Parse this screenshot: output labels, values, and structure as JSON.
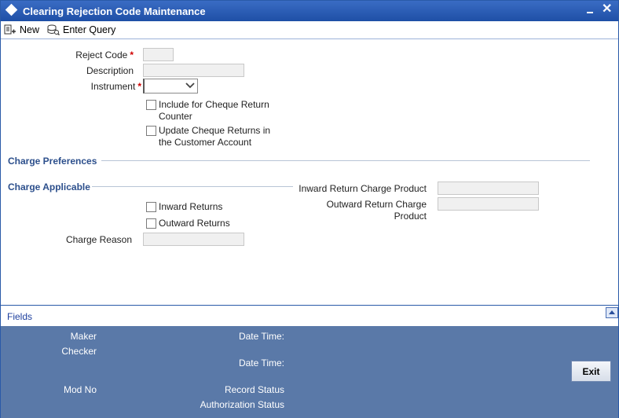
{
  "window": {
    "title": "Clearing Rejection Code Maintenance"
  },
  "toolbar": {
    "new_label": "New",
    "enter_query_label": "Enter Query"
  },
  "form": {
    "reject_code_label": "Reject Code",
    "reject_code_value": "",
    "description_label": "Description",
    "description_value": "",
    "instrument_label": "Instrument",
    "instrument_value": "",
    "required_marker": "*",
    "include_cheque_return_line1": "Include for Cheque Return",
    "include_cheque_return_line2": "Counter",
    "include_cheque_return_checked": false,
    "update_cheque_returns_line1": "Update Cheque Returns in",
    "update_cheque_returns_line2": "the Customer Account",
    "update_cheque_returns_checked": false
  },
  "charge_preferences": {
    "section_title": "Charge Preferences",
    "charge_applicable_title": "Charge Applicable",
    "inward_returns_label": "Inward Returns",
    "inward_returns_checked": false,
    "outward_returns_label": "Outward Returns",
    "outward_returns_checked": false,
    "charge_reason_label": "Charge Reason",
    "charge_reason_value": "",
    "inward_return_charge_product_label": "Inward Return Charge Product",
    "inward_return_charge_product_value": "",
    "outward_return_charge_line1": "Outward Return Charge",
    "outward_return_charge_line2": "Product",
    "outward_return_charge_product_value": ""
  },
  "fields_bar": {
    "label": "Fields"
  },
  "footer": {
    "maker_label": "Maker",
    "checker_label": "Checker",
    "date_time_label_1": "Date Time:",
    "date_time_label_2": "Date Time:",
    "mod_no_label": "Mod No",
    "record_status_label": "Record Status",
    "authorization_status_label": "Authorization Status",
    "exit_label": "Exit"
  },
  "colors": {
    "title_bar": "#1e4fa6",
    "footer_bg": "#5a79a8",
    "section_title": "#2c4f8c",
    "required": "#d00000"
  }
}
